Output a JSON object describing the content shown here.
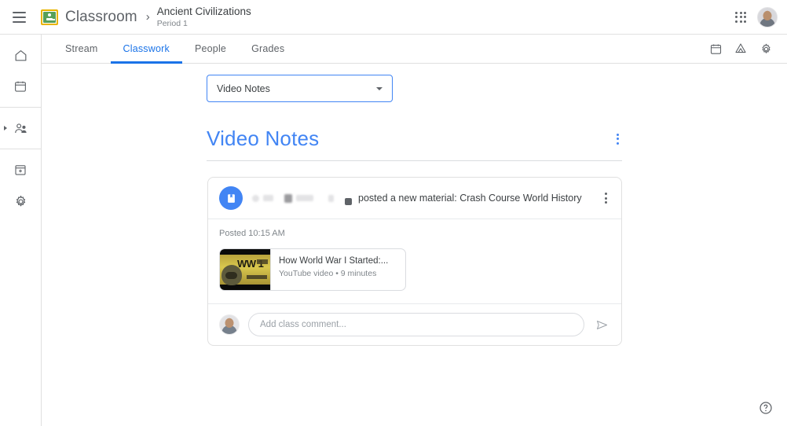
{
  "topbar": {
    "menu_icon": "hamburger-menu-icon",
    "logo_icon": "classroom-logo-icon",
    "brand": "Classroom",
    "breadcrumb_separator": "›",
    "class_name": "Ancient Civilizations",
    "class_section": "Period 1",
    "apps_icon": "google-apps-grid-icon",
    "account_avatar": "account-avatar"
  },
  "rail": {
    "items": [
      {
        "icon": "home-icon",
        "name": "home"
      },
      {
        "icon": "calendar-icon",
        "name": "calendar"
      },
      {
        "icon": "enrolled-people-icon",
        "name": "enrolled",
        "has_caret": true
      },
      {
        "icon": "archived-classes-icon",
        "name": "archived-classes"
      },
      {
        "icon": "settings-gear-icon",
        "name": "settings"
      }
    ]
  },
  "tabs": [
    {
      "label": "Stream",
      "active": false
    },
    {
      "label": "Classwork",
      "active": true
    },
    {
      "label": "People",
      "active": false
    },
    {
      "label": "Grades",
      "active": false
    }
  ],
  "tab_tools": [
    {
      "icon": "calendar-icon",
      "name": "class-calendar"
    },
    {
      "icon": "google-drive-icon",
      "name": "class-drive-folder"
    },
    {
      "icon": "settings-gear-icon",
      "name": "class-settings"
    }
  ],
  "topic_filter": {
    "value": "Video Notes",
    "caret_icon": "chevron-down-icon"
  },
  "topic": {
    "title": "Video Notes",
    "menu_icon": "more-options-icon"
  },
  "post": {
    "avatar_icon": "material-book-icon",
    "author_redacted": true,
    "action_text": "posted a new material: Crash Course World History",
    "menu_icon": "more-options-icon",
    "posted_time": "Posted 10:15 AM",
    "attachment": {
      "title": "How World War I Started:...",
      "meta": "YouTube video • 9 minutes",
      "thumbnail_text": "WW 1"
    },
    "comment": {
      "placeholder": "Add class comment...",
      "value": "",
      "send_icon": "send-icon"
    }
  },
  "help": {
    "icon": "help-circle-icon"
  },
  "colors": {
    "accent_blue": "#1a73e8",
    "title_blue": "#4285f4",
    "text": "#3c4043",
    "muted": "#5f6368",
    "border": "#e0e0e0"
  }
}
